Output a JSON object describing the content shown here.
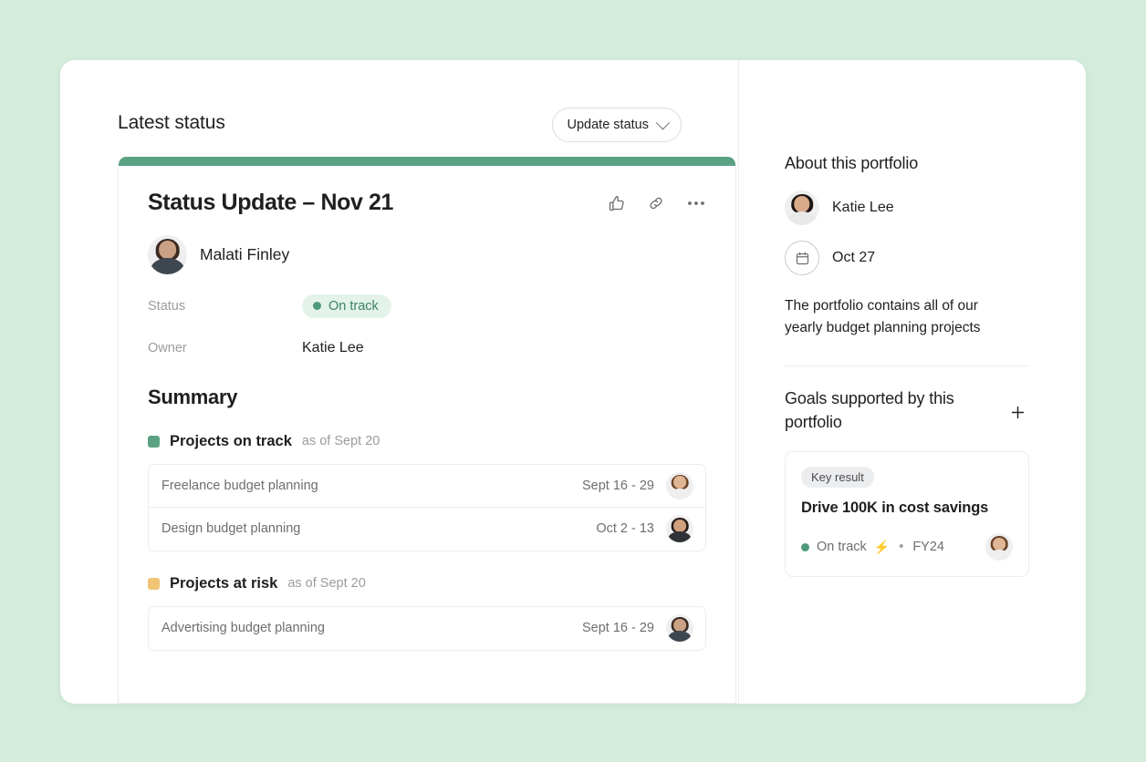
{
  "theme": {
    "page_background": "#d4ecdc",
    "card_background": "#ffffff",
    "accent_green": "#5ba283",
    "status_green_text": "#3c8264",
    "status_green_bg": "#e3f3ea",
    "at_risk_yellow": "#f1c375",
    "border": "#ecedef",
    "muted_text": "#9b9ca0"
  },
  "left": {
    "page_title": "Latest status",
    "update_status_button": {
      "label": "Update status",
      "icon": "chevron-down-icon"
    },
    "status_card": {
      "title": "Status Update – Nov 21",
      "actions": [
        {
          "name": "thumbs-up-icon",
          "label": "Like"
        },
        {
          "name": "link-icon",
          "label": "Copy link"
        },
        {
          "name": "ellipsis-icon",
          "label": "More actions"
        }
      ],
      "author": {
        "name": "Malati Finley",
        "avatar": "avatar-malati-finley"
      },
      "fields": [
        {
          "label": "Status",
          "value": "On track",
          "type": "pill",
          "color": "#3c8264"
        },
        {
          "label": "Owner",
          "value": "Katie Lee",
          "type": "text"
        }
      ],
      "summary_heading": "Summary",
      "groups": [
        {
          "name": "Projects on track",
          "as_of": "as of Sept 20",
          "swatch": "#5ba283",
          "projects": [
            {
              "name": "Freelance budget planning",
              "dates": "Sept 16 - 29",
              "avatar": "avatar-freelance-owner"
            },
            {
              "name": "Design budget planning",
              "dates": "Oct 2 - 13",
              "avatar": "avatar-design-owner"
            }
          ]
        },
        {
          "name": "Projects at risk",
          "as_of": "as of Sept 20",
          "swatch": "#f1c375",
          "projects": [
            {
              "name": "Advertising budget planning",
              "dates": "Sept 16 - 29",
              "avatar": "avatar-advertising-owner"
            }
          ]
        }
      ]
    }
  },
  "right": {
    "about_title": "About this portfolio",
    "owner": {
      "name": "Katie Lee",
      "avatar": "avatar-katie-lee"
    },
    "date": {
      "icon": "calendar-icon",
      "value": "Oct 27"
    },
    "description": "The portfolio contains all of our yearly budget planning projects",
    "goals_title": "Goals supported by this portfolio",
    "add_goal_icon": "plus-icon",
    "goal_card": {
      "tag": "Key result",
      "name": "Drive 100K in cost savings",
      "status": "On track",
      "bolt_icon": "⚡",
      "separator": "•",
      "period": "FY24",
      "avatar": "avatar-goal-owner"
    }
  }
}
